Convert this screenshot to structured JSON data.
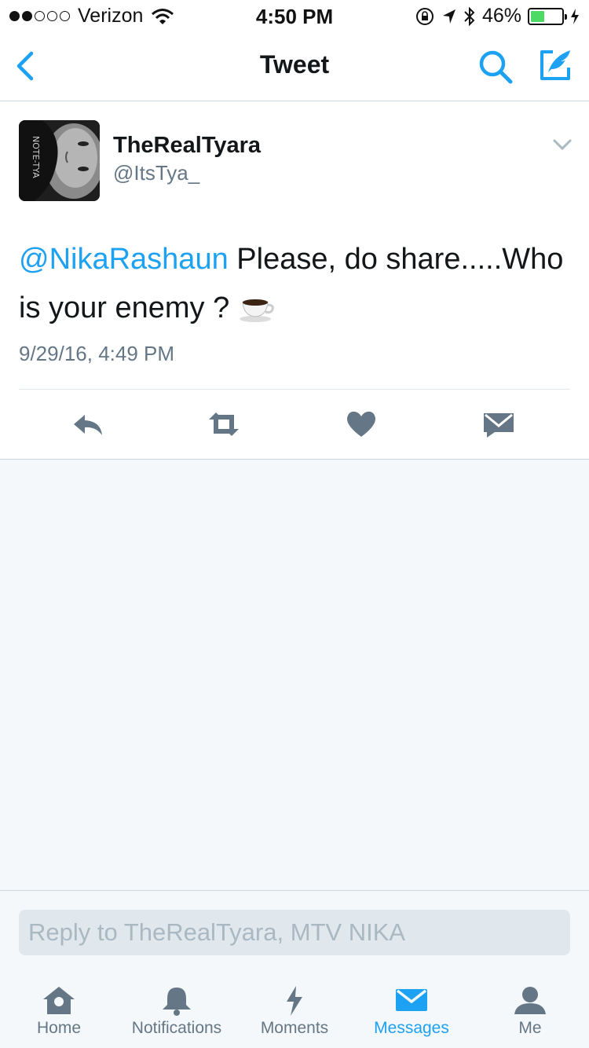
{
  "status_bar": {
    "carrier": "Verizon",
    "time": "4:50 PM",
    "battery": "46%",
    "battery_level": 0.46
  },
  "nav": {
    "title": "Tweet"
  },
  "tweet": {
    "display_name": "TheRealTyara",
    "handle": "@ItsTya_",
    "mention": "@NikaRashaun",
    "text": "Please, do share.....Who is your enemy ?",
    "emoji": "coffee-cup",
    "timestamp": "9/29/16, 4:49 PM"
  },
  "actions": [
    "reply-icon",
    "retweet-icon",
    "like-icon",
    "direct-message-icon"
  ],
  "reply": {
    "placeholder": "Reply to TheRealTyara, MTV NIKA"
  },
  "tabs": [
    {
      "label": "Home",
      "icon": "home-icon",
      "active": false
    },
    {
      "label": "Notifications",
      "icon": "bell-icon",
      "active": false
    },
    {
      "label": "Moments",
      "icon": "lightning-icon",
      "active": false
    },
    {
      "label": "Messages",
      "icon": "envelope-icon",
      "active": true
    },
    {
      "label": "Me",
      "icon": "person-icon",
      "active": false
    }
  ],
  "colors": {
    "accent": "#1da1f2",
    "icon_gray": "#657786",
    "background": "#f5f8fa",
    "battery": "#4cd964"
  }
}
